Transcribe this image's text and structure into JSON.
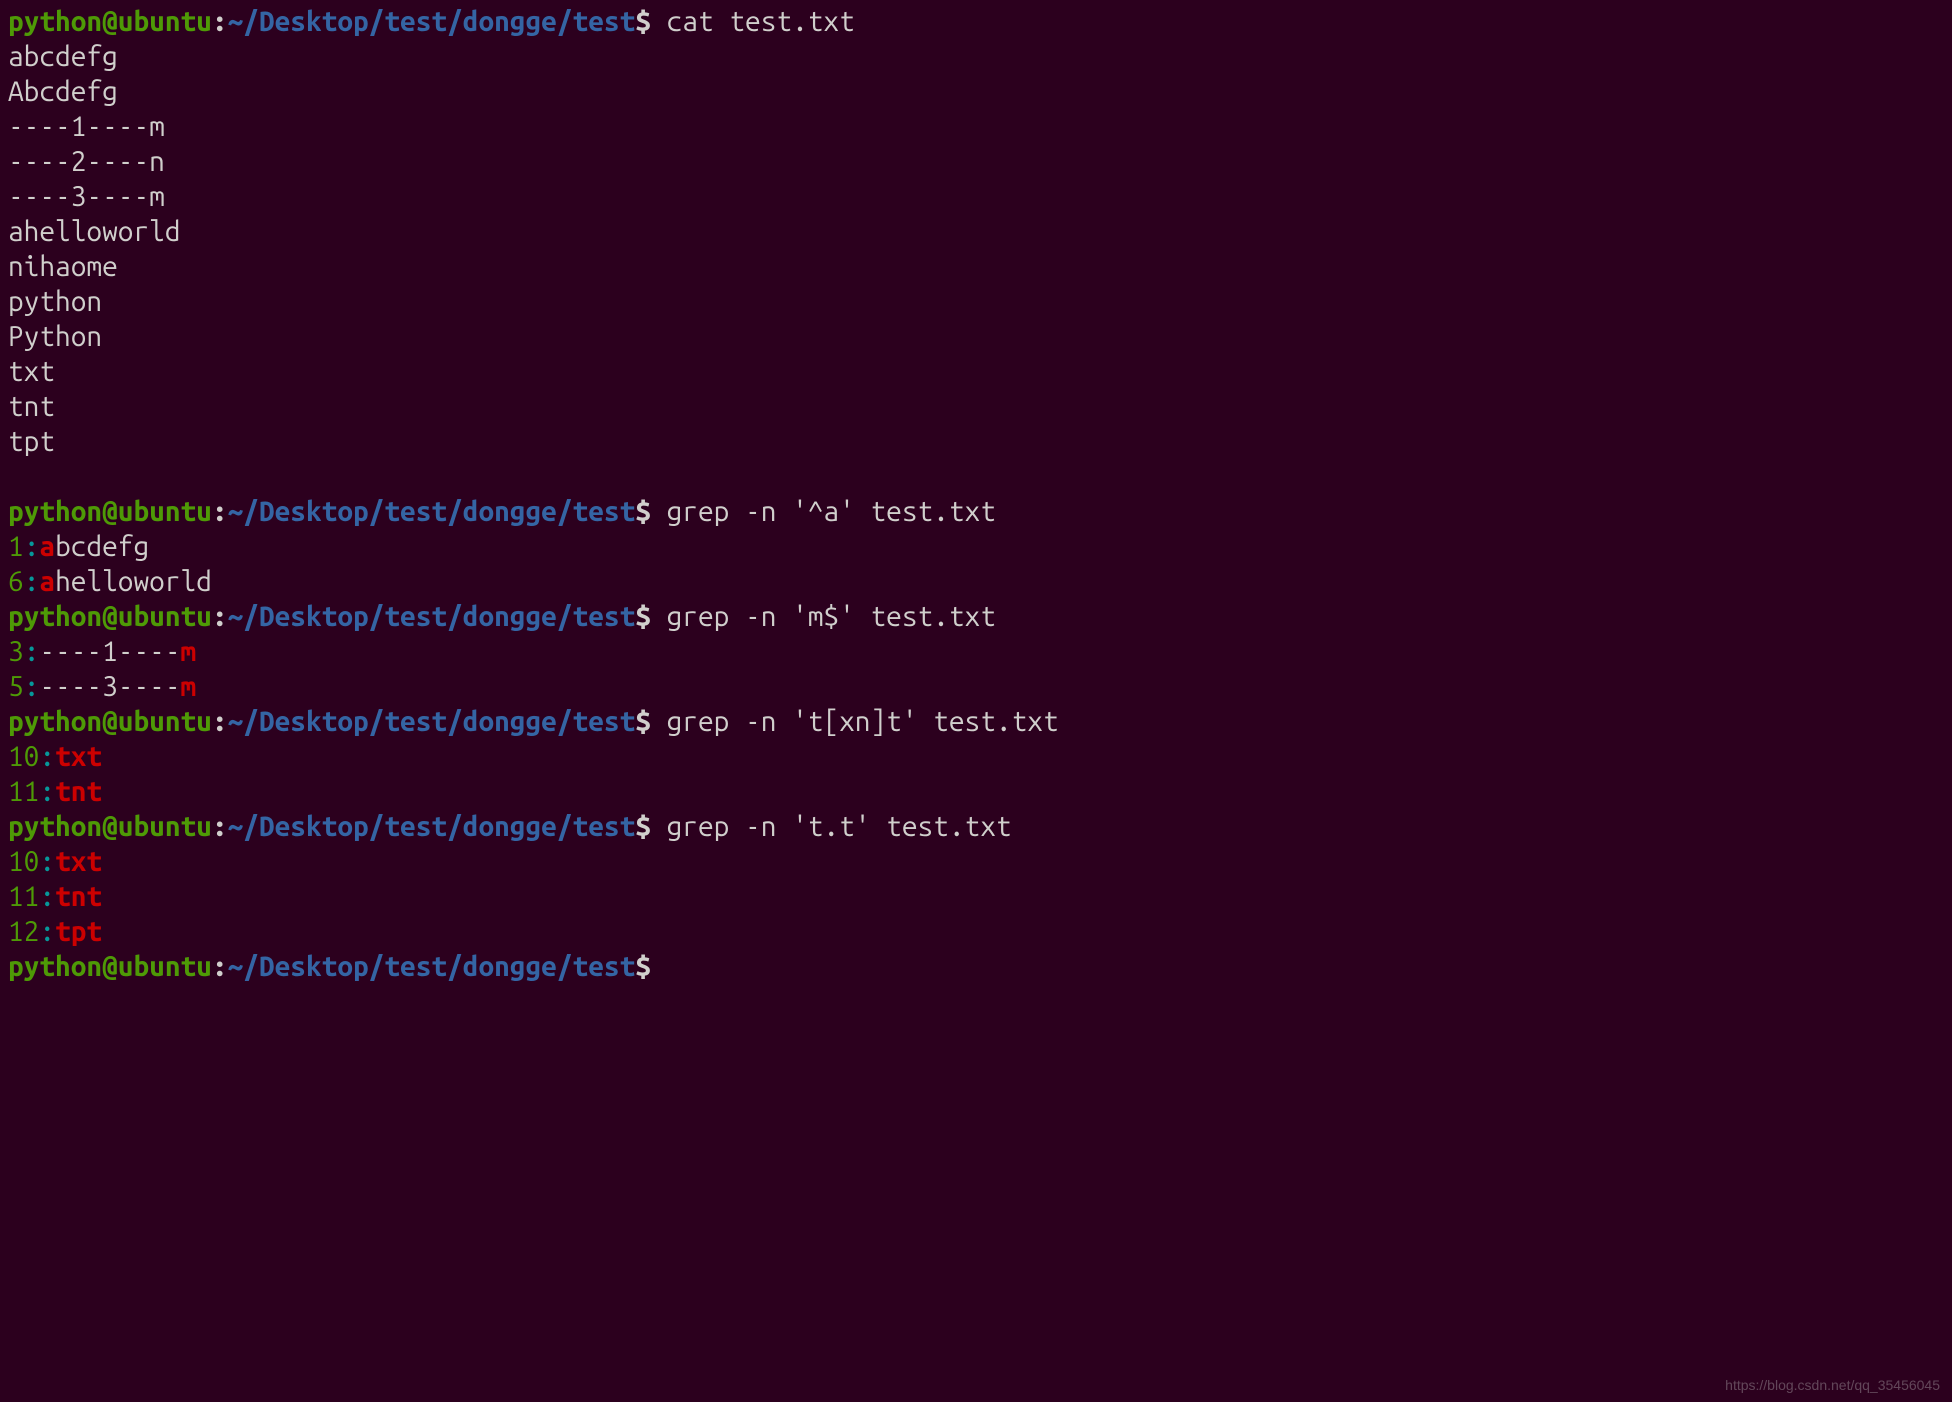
{
  "prompt": {
    "user": "python",
    "at": "@",
    "host": "ubuntu",
    "colon": ":",
    "path": "~/Desktop/test/dongge/test",
    "dollar": "$ "
  },
  "cmd1": "cat test.txt",
  "cat_output": [
    "abcdefg",
    "Abcdefg",
    "----1----m",
    "----2----n",
    "----3----m",
    "ahelloworld",
    "nihaome",
    "python",
    "Python",
    "txt",
    "tnt",
    "tpt",
    ""
  ],
  "cmd2": "grep -n '^a' test.txt",
  "grep2": [
    {
      "lineno": "1",
      "sep": ":",
      "match": "a",
      "rest": "bcdefg"
    },
    {
      "lineno": "6",
      "sep": ":",
      "match": "a",
      "rest": "helloworld"
    }
  ],
  "cmd3": "grep -n 'm$' test.txt",
  "grep3": [
    {
      "lineno": "3",
      "sep": ":",
      "before": "----1----",
      "match": "m"
    },
    {
      "lineno": "5",
      "sep": ":",
      "before": "----3----",
      "match": "m"
    }
  ],
  "cmd4": "grep -n 't[xn]t' test.txt",
  "grep4": [
    {
      "lineno": "10",
      "sep": ":",
      "match": "txt"
    },
    {
      "lineno": "11",
      "sep": ":",
      "match": "tnt"
    }
  ],
  "cmd5": "grep -n 't.t' test.txt",
  "grep5": [
    {
      "lineno": "10",
      "sep": ":",
      "match": "txt"
    },
    {
      "lineno": "11",
      "sep": ":",
      "match": "tnt"
    },
    {
      "lineno": "12",
      "sep": ":",
      "match": "tpt"
    }
  ],
  "watermark": "https://blog.csdn.net/qq_35456045"
}
